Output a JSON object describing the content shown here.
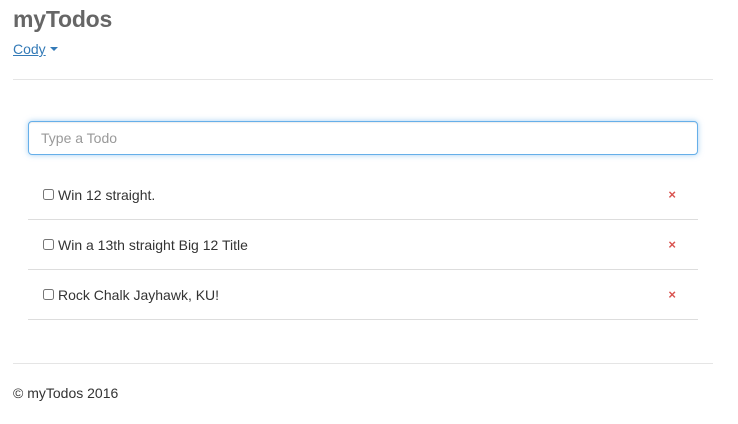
{
  "header": {
    "brand": "myTodos",
    "user_name": "Cody"
  },
  "new_todo": {
    "placeholder": "Type a Todo",
    "value": ""
  },
  "todos": [
    {
      "text": "Win 12 straight.",
      "done": false,
      "remove_icon": "×"
    },
    {
      "text": "Win a 13th straight Big 12 Title",
      "done": false,
      "remove_icon": "×"
    },
    {
      "text": "Rock Chalk Jayhawk, KU!",
      "done": false,
      "remove_icon": "×"
    }
  ],
  "footer": {
    "text": "© myTodos 2016"
  },
  "colors": {
    "link": "#337ab7",
    "remove": "#d9534f",
    "focus_border": "#66afe9"
  }
}
